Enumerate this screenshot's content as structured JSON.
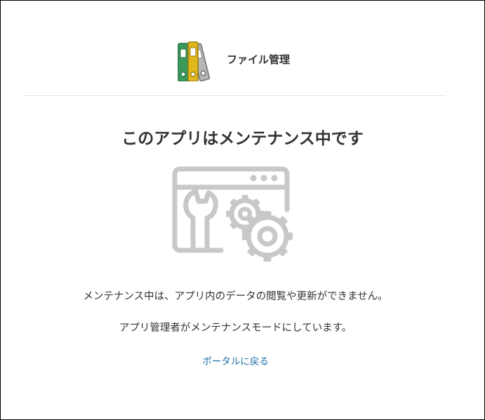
{
  "app": {
    "name": "ファイル管理",
    "logo_icon": "binders-icon"
  },
  "main": {
    "title": "このアプリはメンテナンス中です",
    "illustration_icon": "maintenance-window-gears-wrench-icon",
    "message_line1": "メンテナンス中は、アプリ内のデータの閲覧や更新ができません。",
    "message_line2": "アプリ管理者がメンテナンスモードにしています。",
    "portal_link": "ポータルに戻る"
  },
  "colors": {
    "text": "#333333",
    "link": "#1d6fa5",
    "divider": "#e1e1e1",
    "illustration": "#c8c8c8",
    "binder_green": "#3a9a5a",
    "binder_yellow": "#e0b81c",
    "binder_gray": "#b5b5b5"
  }
}
